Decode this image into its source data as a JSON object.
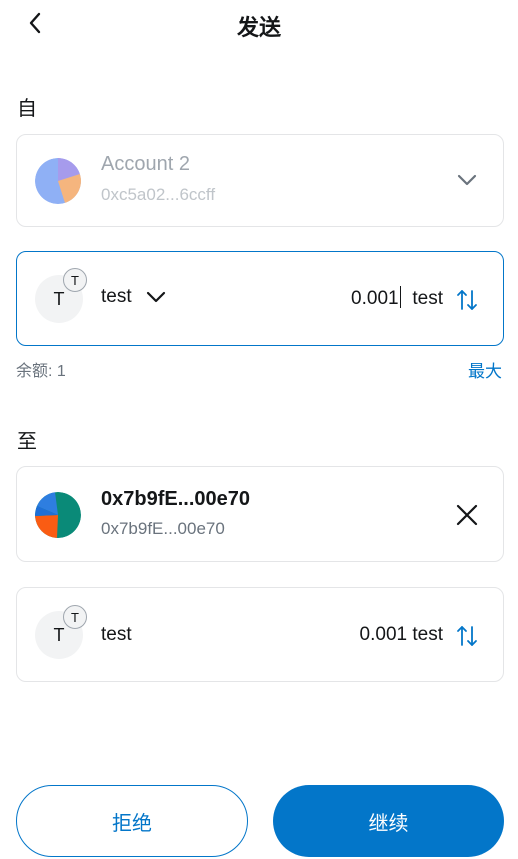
{
  "header": {
    "title": "发送"
  },
  "from": {
    "label": "自",
    "account_name": "Account 2",
    "account_address": "0xc5a02...6ccff"
  },
  "asset": {
    "token_symbol_letter": "T",
    "token_badge_letter": "T",
    "token_name": "test",
    "amount_value": "0.001",
    "amount_unit": "test"
  },
  "balance": {
    "text": "余额: 1",
    "max_label": "最大"
  },
  "to": {
    "label": "至",
    "name": "0x7b9fE...00e70",
    "address": "0x7b9fE...00e70"
  },
  "receive": {
    "token_symbol_letter": "T",
    "token_badge_letter": "T",
    "token_name": "test",
    "amount": "0.001 test"
  },
  "footer": {
    "reject_label": "拒绝",
    "continue_label": "继续"
  },
  "colors": {
    "accent": "#0376c9",
    "border": "#e4e5e7",
    "muted": "#9fa6ae"
  }
}
